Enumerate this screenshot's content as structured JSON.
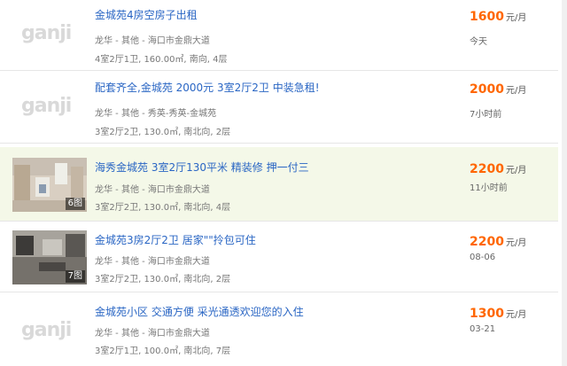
{
  "colors": {
    "title": "#2a66c4",
    "price": "#ff6600",
    "highlight": "#f4f8e8"
  },
  "listings": [
    {
      "thumb_type": "logo",
      "logo_text": "ganji",
      "title": "金城苑4房空房子出租",
      "location": "龙华 - 其他 - 海口市金鼎大道",
      "specs": "4室2厅1卫, 160.00㎡, 南向, 4层",
      "price": "1600",
      "price_unit": "元/月",
      "time": "今天"
    },
    {
      "thumb_type": "logo",
      "logo_text": "ganji",
      "title": "配套齐全,金城苑 2000元 3室2厅2卫 中装急租!",
      "location": "龙华 - 其他 - 秀英-秀英-金城苑",
      "specs": "3室2厅2卫, 130.0㎡, 南北向, 2层",
      "price": "2000",
      "price_unit": "元/月",
      "time": "7小时前"
    },
    {
      "thumb_type": "photo",
      "photo_count": "6图",
      "title": "海秀金城苑 3室2厅130平米 精装修 押一付三",
      "location": "龙华 - 其他 - 海口市金鼎大道",
      "specs": "3室2厅2卫, 130.0㎡, 南北向, 4层",
      "price": "2200",
      "price_unit": "元/月",
      "time": "11小时前",
      "highlight": true
    },
    {
      "thumb_type": "photo",
      "photo_count": "7图",
      "title": "金城苑3房2厅2卫 居家\"\"拎包可住",
      "location": "龙华 - 其他 - 海口市金鼎大道",
      "specs": "3室2厅2卫, 130.0㎡, 南北向, 2层",
      "price": "2200",
      "price_unit": "元/月",
      "time": "08-06"
    },
    {
      "thumb_type": "logo",
      "logo_text": "ganji",
      "title": "金城苑小区 交通方便 采光通透欢迎您的入住",
      "location": "龙华 - 其他 - 海口市金鼎大道",
      "specs": "3室2厅1卫, 100.0㎡, 南北向, 7层",
      "price": "1300",
      "price_unit": "元/月",
      "time": "03-21"
    }
  ]
}
